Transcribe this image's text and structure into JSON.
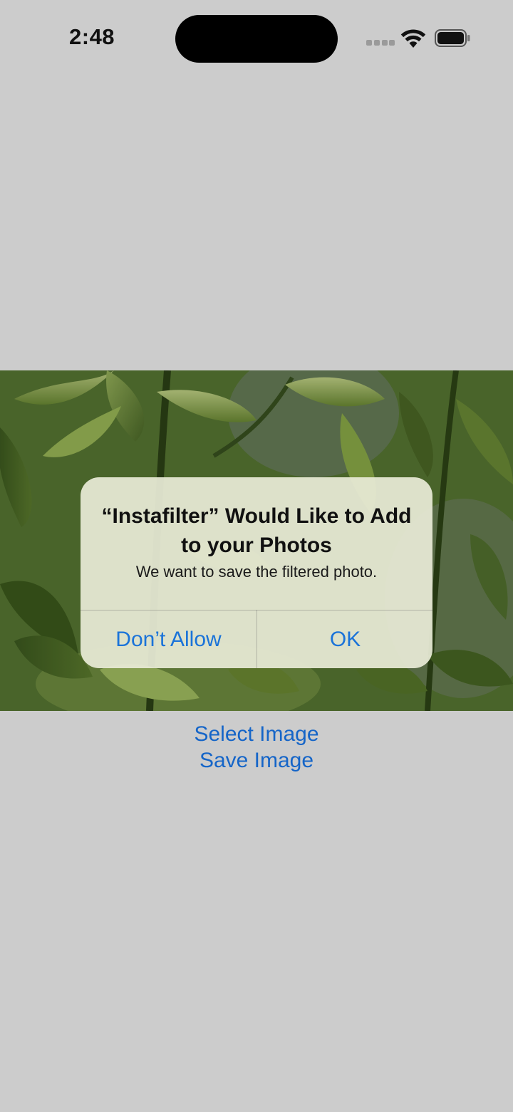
{
  "status_bar": {
    "time": "2:48",
    "icons": [
      "cellular-signal-icon",
      "wifi-icon",
      "battery-icon"
    ]
  },
  "photo": {
    "description_icon": "photo"
  },
  "actions": {
    "select_image": "Select Image",
    "save_image": "Save Image"
  },
  "alert": {
    "title": "“Instafilter” Would Like to Add to your Photos",
    "message": "We want to save the filtered photo.",
    "buttons": {
      "dont_allow": "Don’t Allow",
      "ok": "OK"
    }
  },
  "colors": {
    "background": "#cccccc",
    "link_blue": "#1565c8",
    "alert_blue": "#1a73d9"
  }
}
